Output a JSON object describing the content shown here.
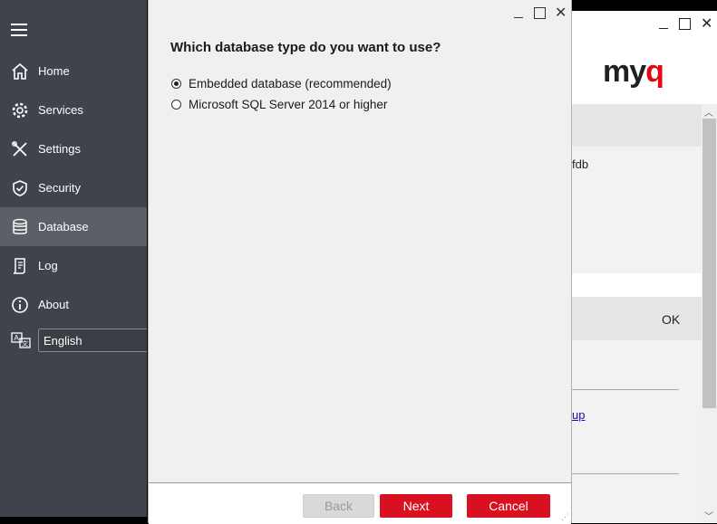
{
  "sidebar": {
    "items": [
      {
        "label": "Home",
        "icon": "home-icon"
      },
      {
        "label": "Services",
        "icon": "gear-icon"
      },
      {
        "label": "Settings",
        "icon": "wrench-screwdriver-icon"
      },
      {
        "label": "Security",
        "icon": "shield-check-icon"
      },
      {
        "label": "Database",
        "icon": "database-icon",
        "active": true
      },
      {
        "label": "Log",
        "icon": "log-icon"
      },
      {
        "label": "About",
        "icon": "info-icon"
      }
    ],
    "language": {
      "icon": "translate-icon",
      "value": "English"
    }
  },
  "background_window": {
    "logo_text": "myq",
    "partial_text": "fdb",
    "ok_label": "OK",
    "link_text": "up"
  },
  "dialog": {
    "question": "Which database type do you want to use?",
    "options": [
      {
        "label": "Embedded database (recommended)",
        "selected": true
      },
      {
        "label": "Microsoft SQL Server 2014 or higher",
        "selected": false
      }
    ],
    "buttons": {
      "back": "Back",
      "next": "Next",
      "cancel": "Cancel"
    }
  },
  "colors": {
    "accent": "#d8101f",
    "sidebar_bg": "#3f434b",
    "sidebar_active": "#5b5f68"
  }
}
